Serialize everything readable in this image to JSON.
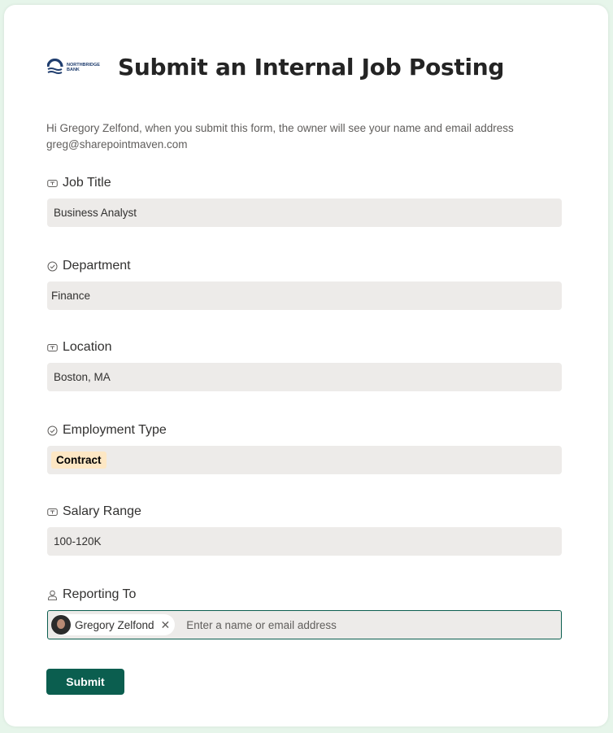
{
  "header": {
    "logo_text_line1": "NORTHBRIDGE",
    "logo_text_line2": "BANK",
    "title": "Submit an Internal Job Posting"
  },
  "intro": "Hi Gregory Zelfond, when you submit this form, the owner will see your name and email address greg@sharepointmaven.com",
  "fields": [
    {
      "label": "Job Title",
      "icon": "text-field-icon",
      "value": "Business Analyst"
    },
    {
      "label": "Department",
      "icon": "choice-icon",
      "value": "Finance"
    },
    {
      "label": "Location",
      "icon": "text-field-icon",
      "value": "Boston, MA"
    },
    {
      "label": "Employment Type",
      "icon": "choice-icon",
      "value": "Contract"
    },
    {
      "label": "Salary Range",
      "icon": "text-field-icon",
      "value": "100-120K"
    },
    {
      "label": "Reporting To",
      "icon": "person-icon",
      "person": "Gregory Zelfond",
      "placeholder": "Enter a name or email address"
    }
  ],
  "submit_label": "Submit",
  "colors": {
    "accent": "#0b5e4f",
    "input_bg": "#edebe9",
    "choice_pill": "#fde7c4",
    "page_bg": "#e6f5ea"
  }
}
